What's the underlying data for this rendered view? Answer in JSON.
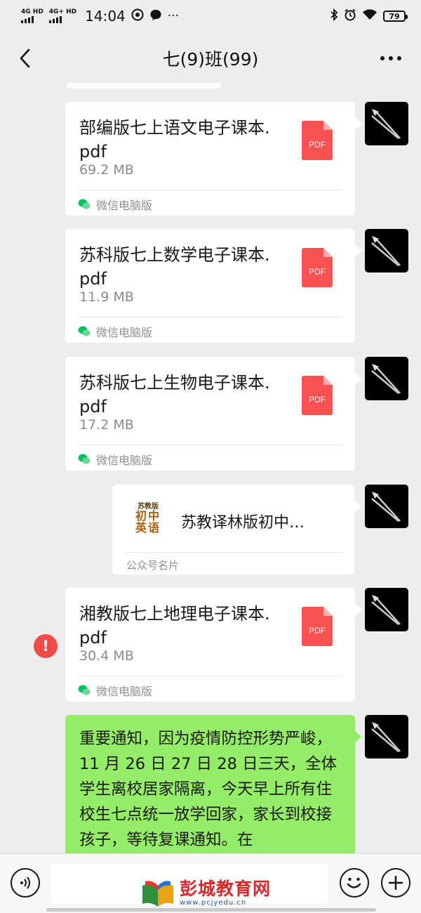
{
  "status_bar": {
    "signal1_label": "4G HD",
    "signal2_label": "4G+ HD",
    "time": "14:04",
    "more": "···",
    "battery": "79",
    "icons": [
      "bluetooth-icon",
      "alarm-icon",
      "wifi-icon",
      "battery-icon"
    ]
  },
  "nav": {
    "title": "七(9)班(99)"
  },
  "messages": [
    {
      "type": "file",
      "name": "部编版七上语文电子课本.pdf",
      "name_line1": "部编版七上语文电子课本.",
      "name_line2": "pdf",
      "size": "69.2 MB",
      "icon_label": "PDF",
      "source": "微信电脑版"
    },
    {
      "type": "file",
      "name": "苏科版七上数学电子课本.pdf",
      "name_line1": "苏科版七上数学电子课本.",
      "name_line2": "pdf",
      "size": "11.9 MB",
      "icon_label": "PDF",
      "source": "微信电脑版"
    },
    {
      "type": "file",
      "name": "苏科版七上生物电子课本.pdf",
      "name_line1": "苏科版七上生物电子课本.",
      "name_line2": "pdf",
      "size": "17.2 MB",
      "icon_label": "PDF",
      "source": "微信电脑版"
    },
    {
      "type": "official_account_card",
      "logo_line1": "苏教版",
      "logo_line2": "初中",
      "logo_line3": "英语",
      "title": "苏教译林版初中…",
      "footer": "公众号名片"
    },
    {
      "type": "file",
      "name": "湘教版七上地理电子课本.pdf",
      "name_line1": "湘教版七上地理电子课本.",
      "name_line2": "pdf",
      "size": "30.4 MB",
      "icon_label": "PDF",
      "source": "微信电脑版",
      "error_icon": "!"
    },
    {
      "type": "text",
      "text": "重要通知，因为疫情防控形势严峻，11 月 26 日 27 日 28 日三天，全体学生离校居家隔离，今天早上所有住校生七点统一放学回家，家长到校接孩子，等待复课通知。在"
    }
  ],
  "watermark": {
    "title": "彭城教育网",
    "url": "www.pcjyedu.cn"
  },
  "colors": {
    "background": "#ededed",
    "sent_bubble": "#95ec69",
    "pdf_red": "#fa5151",
    "error_red": "#f04a4a",
    "wechat_green": "#07c160"
  }
}
